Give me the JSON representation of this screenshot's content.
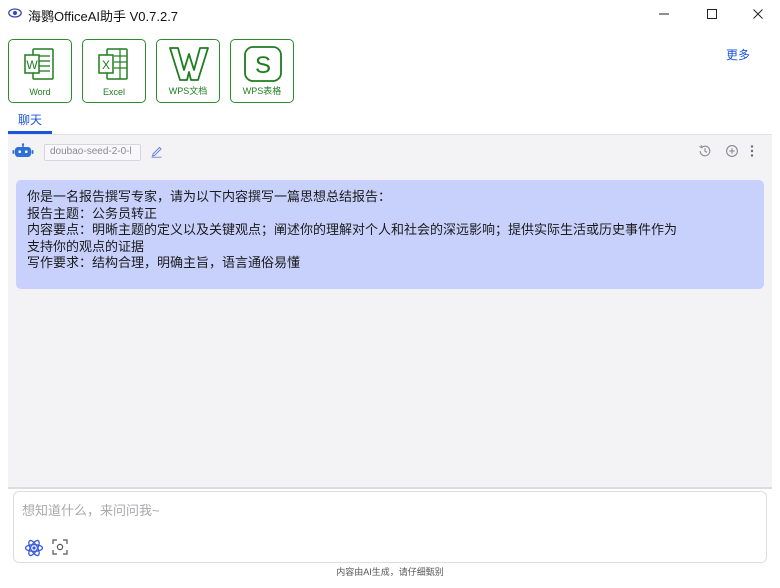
{
  "window": {
    "title": "海鹦OfficeAI助手 V0.7.2.7",
    "app_icon": "eye-logo-icon",
    "controls": [
      "minimize-icon",
      "maximize-icon",
      "close-icon"
    ]
  },
  "toolbar": {
    "apps": [
      {
        "label": "Word",
        "icon": "word-icon"
      },
      {
        "label": "Excel",
        "icon": "excel-icon"
      },
      {
        "label": "WPS文档",
        "icon": "wps-doc-icon"
      },
      {
        "label": "WPS表格",
        "icon": "wps-sheet-icon"
      }
    ],
    "more_label": "更多"
  },
  "tabs": [
    {
      "label": "聊天",
      "active": true
    }
  ],
  "chat": {
    "model_selector": "doubao-seed-2-0-l",
    "header_icons": [
      "bot-icon",
      "edit-icon",
      "history-icon",
      "new-chat-icon",
      "more-icon"
    ],
    "message_lines": [
      "你是一名报告撰写专家，请为以下内容撰写一篇思想总结报告：",
      "报告主题：公务员转正",
      "内容要点：明晰主题的定义以及关键观点；阐述你的理解对个人和社会的深远影响；提供实际生活或历史事件作为",
      "支持你的观点的证据",
      "写作要求：结构合理，明确主旨，语言通俗易懂"
    ]
  },
  "input": {
    "placeholder": "想知道什么，来问问我~",
    "value": "",
    "icons": [
      "atom-icon",
      "scan-icon"
    ]
  },
  "footer": {
    "note": "内容由AI生成，请仔细甄别"
  },
  "colors": {
    "accent": "#1a56db",
    "brand_green": "#1e7d1e",
    "bubble": "#c8d1fc",
    "chat_bg": "#f3f3f5"
  }
}
